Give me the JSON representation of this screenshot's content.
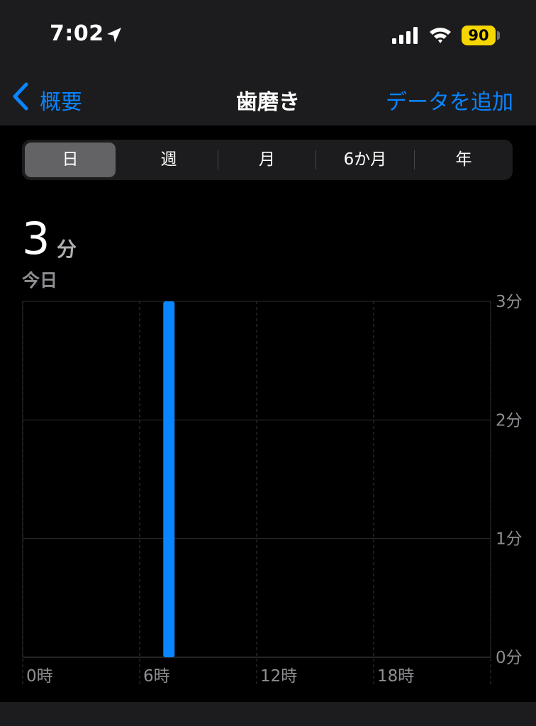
{
  "status_bar": {
    "time": "7:02",
    "battery": "90",
    "icons": [
      "location-arrow-icon",
      "cellular-signal-icon",
      "wifi-icon"
    ]
  },
  "nav": {
    "back_label": "概要",
    "title": "歯磨き",
    "add_label": "データを追加"
  },
  "segments": {
    "items": [
      "日",
      "週",
      "月",
      "6か月",
      "年"
    ],
    "selected": "日"
  },
  "summary": {
    "value": "3",
    "unit": "分",
    "period": "今日"
  },
  "colors": {
    "accent": "#0a84ff",
    "bar": "#0a84ff",
    "background": "#000000",
    "panel": "#1c1c1e"
  },
  "chart_data": {
    "type": "bar",
    "x_tick_labels": [
      "0時",
      "6時",
      "12時",
      "18時"
    ],
    "y_tick_labels": [
      "3分",
      "2分",
      "1分",
      "0分"
    ],
    "ylim": [
      0,
      3
    ],
    "y_unit": "分",
    "xlim_hours": [
      0,
      24
    ],
    "bars": [
      {
        "hour": 7,
        "value": 3
      }
    ],
    "grid": true
  }
}
